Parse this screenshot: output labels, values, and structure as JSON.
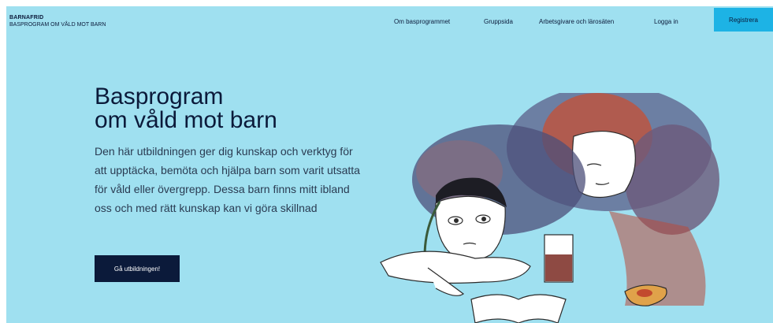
{
  "header": {
    "brand_line1": "BARNAFRID",
    "brand_line2": "BASPROGRAM OM VÅLD MOT BARN",
    "nav": [
      {
        "label": "Om basprogrammet"
      },
      {
        "label": "Gruppsida"
      },
      {
        "label": "Arbetsgivare och lärosäten"
      },
      {
        "label": "Logga in"
      }
    ],
    "register_label": "Registrera"
  },
  "hero": {
    "title_line1": "Basprogram",
    "title_line2": "om våld mot barn",
    "lead": "Den här utbildningen ger dig kunskap och verktyg för att upptäcka, bemöta och hjälpa barn som varit utsatta för våld eller övergrepp. Dessa barn finns mitt ibland oss och med rätt kunskap kan vi göra skillnad",
    "button_label": "Gå utbildningen!"
  },
  "colors": {
    "background": "#9fe0f0",
    "primary_dark": "#0b1a3a",
    "accent": "#1db3e5"
  }
}
